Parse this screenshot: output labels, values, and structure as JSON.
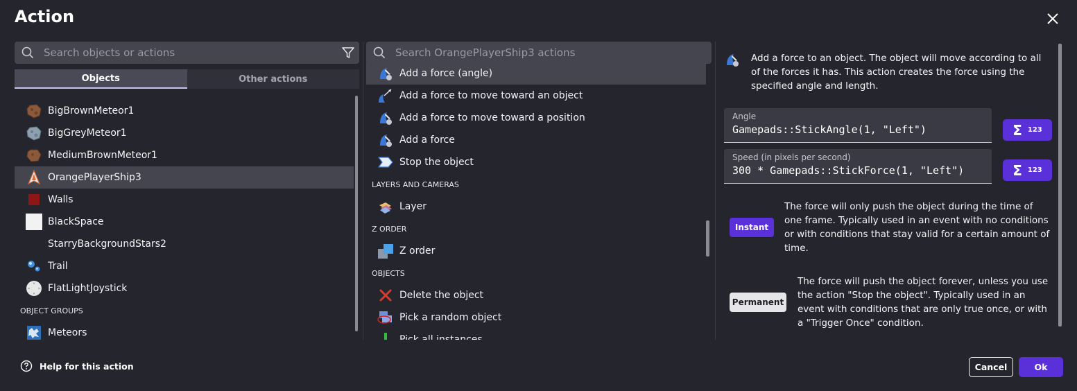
{
  "dialog": {
    "title": "Action"
  },
  "left": {
    "search_placeholder": "Search objects or actions",
    "tabs": [
      {
        "label": "Objects",
        "active": true
      },
      {
        "label": "Other actions",
        "active": false
      }
    ],
    "objects": [
      {
        "label": "BigBrownMeteor1",
        "icon": "brown-meteor-icon"
      },
      {
        "label": "BigGreyMeteor1",
        "icon": "grey-meteor-icon"
      },
      {
        "label": "MediumBrownMeteor1",
        "icon": "brown-meteor-icon"
      },
      {
        "label": "OrangePlayerShip3",
        "icon": "ship-icon",
        "selected": true
      },
      {
        "label": "Walls",
        "icon": "red-square-icon"
      },
      {
        "label": "BlackSpace",
        "icon": "white-square-icon"
      },
      {
        "label": "StarryBackgroundStars2",
        "icon": "none"
      },
      {
        "label": "Trail",
        "icon": "particle-icon"
      },
      {
        "label": "FlatLightJoystick",
        "icon": "joystick-icon"
      }
    ],
    "groups_header": "OBJECT GROUPS",
    "groups": [
      {
        "label": "Meteors",
        "icon": "group-icon"
      }
    ]
  },
  "middle": {
    "search_placeholder": "Search OrangePlayerShip3 actions",
    "items": [
      {
        "type": "action",
        "label": "Add a force (angle)",
        "selected": true,
        "icon": "force-icon"
      },
      {
        "type": "action",
        "label": "Add a force to move toward an object",
        "icon": "force-toward-object-icon"
      },
      {
        "type": "action",
        "label": "Add a force to move toward a position",
        "icon": "force-icon"
      },
      {
        "type": "action",
        "label": "Add a force",
        "icon": "force-icon"
      },
      {
        "type": "action",
        "label": "Stop the object",
        "icon": "stop-icon"
      },
      {
        "type": "group",
        "label": "LAYERS AND CAMERAS"
      },
      {
        "type": "action",
        "label": "Layer",
        "icon": "layer-icon"
      },
      {
        "type": "group",
        "label": "Z ORDER"
      },
      {
        "type": "action",
        "label": "Z order",
        "icon": "z-order-icon"
      },
      {
        "type": "group",
        "label": "OBJECTS"
      },
      {
        "type": "action",
        "label": "Delete the object",
        "icon": "delete-icon"
      },
      {
        "type": "action",
        "label": "Pick a random object",
        "icon": "pick-random-icon"
      },
      {
        "type": "action",
        "label": "Pick all instances",
        "icon": "pick-all-icon"
      }
    ]
  },
  "right": {
    "description": "Add a force to an object. The object will move according to all of the forces it has. This action creates the force using the specified angle and length.",
    "fields": [
      {
        "label": "Angle",
        "value": "Gamepads::StickAngle(1, \"Left\")"
      },
      {
        "label": "Speed (in pixels per second)",
        "value": "300 * Gamepads::StickForce(1, \"Left\")"
      }
    ],
    "expr_button_label": "123",
    "options": [
      {
        "label": "Instant",
        "selected": true,
        "text": "The force will only push the object during the time of one frame. Typically used in an event with no conditions or with conditions that stay valid for a certain amount of time."
      },
      {
        "label": "Permanent",
        "selected": false,
        "text": "The force will push the object forever, unless you use the action \"Stop the object\". Typically used in an event with conditions that are only true once, or with a \"Trigger Once\" condition."
      }
    ]
  },
  "footer": {
    "help": "Help for this action",
    "cancel": "Cancel",
    "ok": "Ok"
  },
  "colors": {
    "background": "#25252d",
    "accent": "#5a30d8",
    "selected_row": "#45454f",
    "panel": "#45454f"
  }
}
